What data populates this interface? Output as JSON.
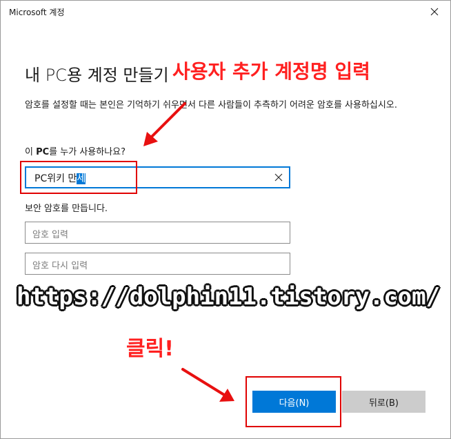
{
  "window": {
    "title": "Microsoft 계정"
  },
  "heading": "내 PC용 계정 만들기",
  "description": "암호를 설정할 때는 본인은 기억하기 쉬우면서 다른 사람들이 추측하기 어려운 암호를 사용하십시오.",
  "who_label": {
    "prefix": "이 ",
    "bold": "PC",
    "suffix": "를 누가 사용하나요?"
  },
  "name_input": {
    "value_plain": "PC위키 만",
    "value_selected": "세"
  },
  "password_label": "보안 암호를 만듭니다.",
  "password_input": {
    "placeholder": "암호 입력"
  },
  "password_confirm": {
    "placeholder": "암호 다시 입력"
  },
  "buttons": {
    "next": "다음(N)",
    "back": "뒤로(B)"
  },
  "annotations": {
    "top_label": "사용자 추가 계정명 입력",
    "url": "https://dolphin11.tistory.com/",
    "click_label": "클릭!"
  },
  "colors": {
    "accent": "#0078d7",
    "annotation_red": "#ff2020",
    "back_button": "#cccccc"
  },
  "icons": {
    "close": "close-icon",
    "clear": "clear-x-icon",
    "arrow": "red-arrow"
  }
}
